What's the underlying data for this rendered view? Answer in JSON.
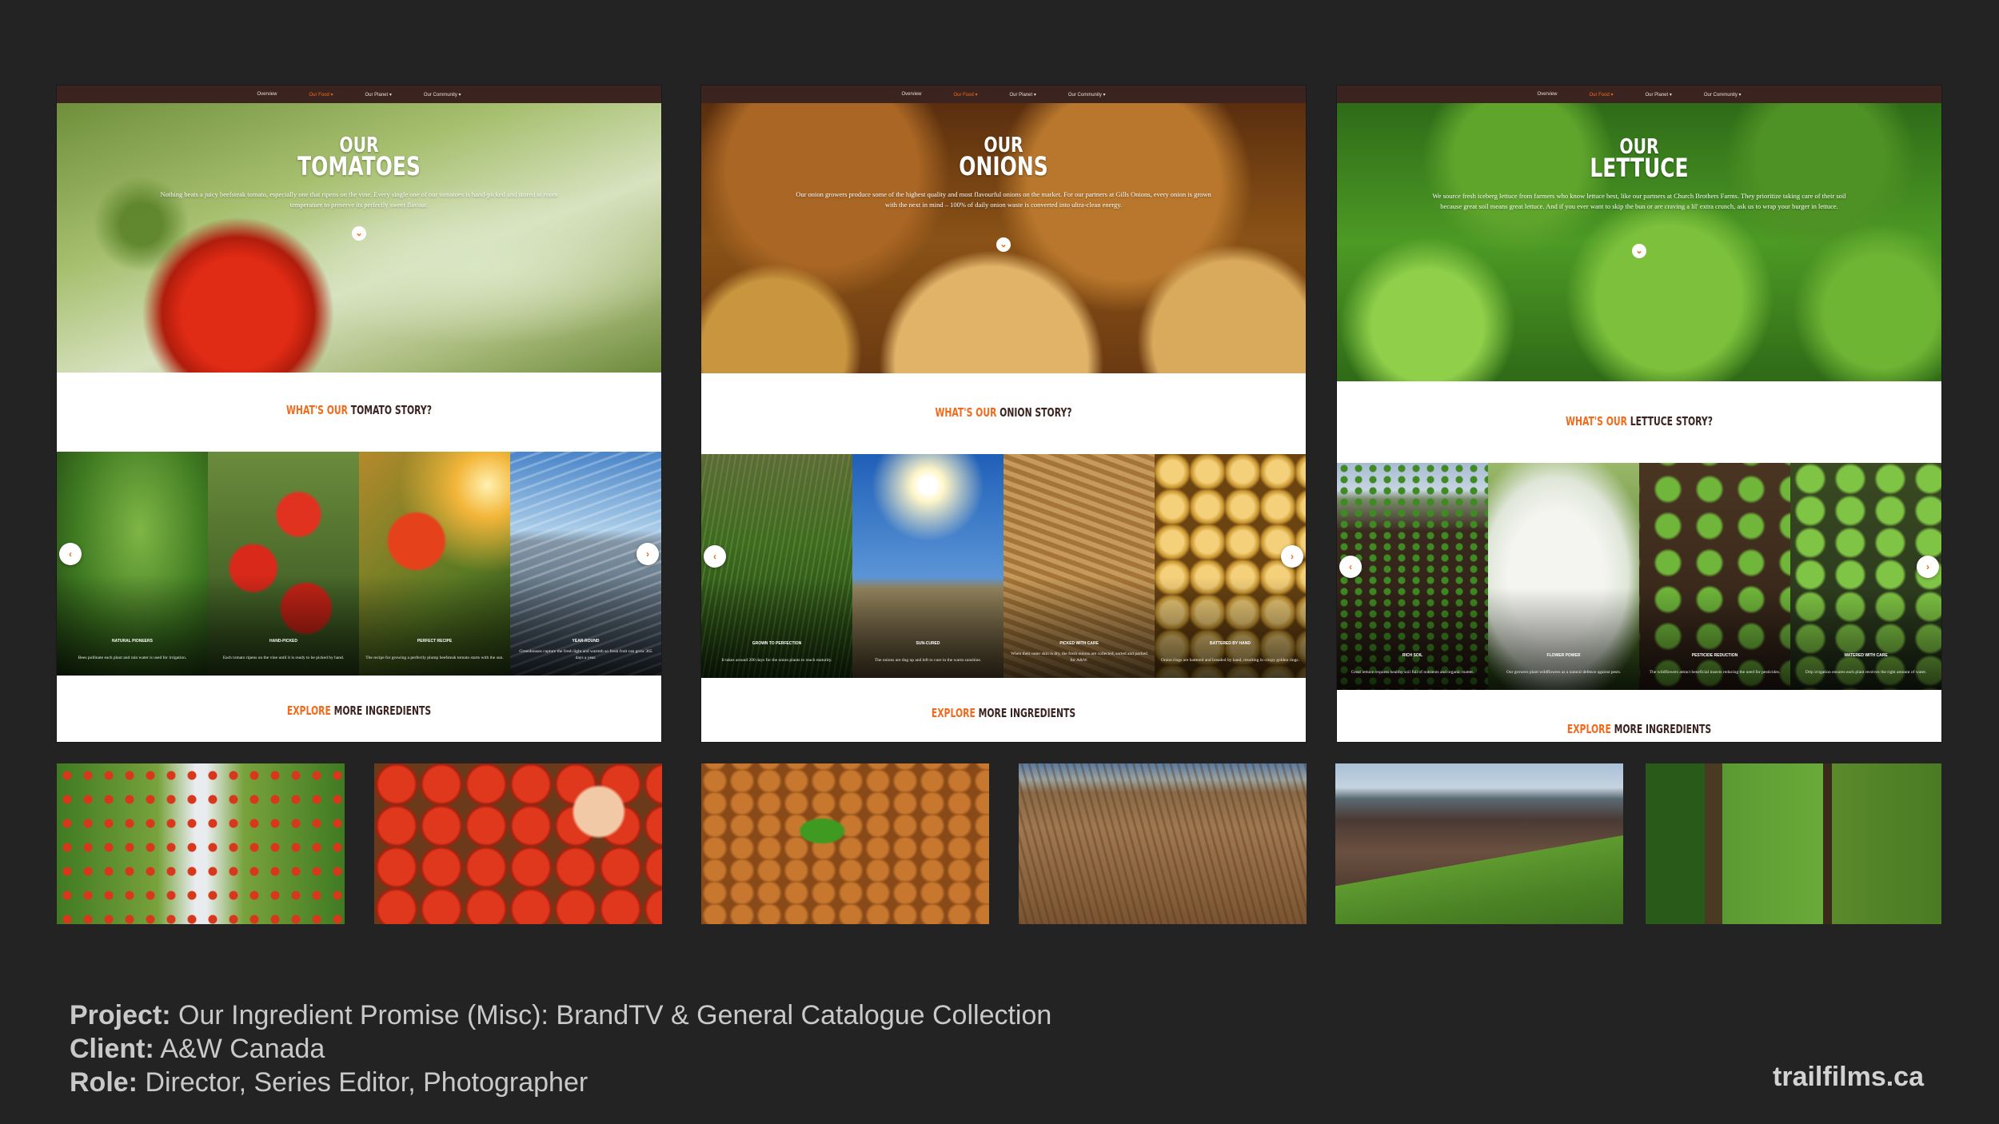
{
  "nav": {
    "items": [
      "Overview",
      "Our Food ▾",
      "Our Planet ▾",
      "Our Community ▾"
    ],
    "active_index": 1
  },
  "pages": [
    {
      "id": "tomatoes",
      "hero_line1": "OUR",
      "hero_line2": "TOMATOES",
      "hero_desc": "Nothing beats a juicy beefsteak tomato, especially one that ripens on the vine. Every single one of our tomatoes is hand-picked and stored at room temperature to preserve its perfectly sweet flavour.",
      "story_orange": "WHAT'S OUR",
      "story_dark": "TOMATO STORY?",
      "tiles": [
        {
          "title": "Natural Pioneers",
          "caption": "Bees pollinate each plant and rain water is used for irrigation."
        },
        {
          "title": "Hand-Picked",
          "caption": "Each tomato ripens on the vine until it is ready to be picked by hand."
        },
        {
          "title": "Perfect Recipe",
          "caption": "The recipe for growing a perfectly plump beefsteak tomato starts with the sun."
        },
        {
          "title": "Year-Round",
          "caption": "Greenhouses capture the fresh light and warmth so fresh fruit can grow 365 days a year."
        }
      ],
      "explore_orange": "EXPLORE",
      "explore_dark": "MORE INGREDIENTS"
    },
    {
      "id": "onions",
      "hero_line1": "OUR",
      "hero_line2": "ONIONS",
      "hero_desc": "Our onion growers produce some of the highest quality and most flavourful onions on the market. For our partners at Gills Onions, every onion is grown with the next in mind – 100% of daily onion waste is converted into ultra-clean energy.",
      "story_orange": "WHAT'S OUR",
      "story_dark": "ONION STORY?",
      "tiles": [
        {
          "title": "Grown to Perfection",
          "caption": "It takes around 200 days for the onion plants to reach maturity."
        },
        {
          "title": "Sun-Cured",
          "caption": "The onions are dug up and left to cure in the warm sunshine."
        },
        {
          "title": "Picked With Care",
          "caption": "When their outer skin is dry, the fresh onions are collected, sorted and packed for A&W."
        },
        {
          "title": "Battered by Hand",
          "caption": "Onion rings are battered and breaded by hand, resulting in crispy golden rings."
        }
      ],
      "explore_orange": "EXPLORE",
      "explore_dark": "MORE INGREDIENTS"
    },
    {
      "id": "lettuce",
      "hero_line1": "OUR",
      "hero_line2": "LETTUCE",
      "hero_desc": "We source fresh iceberg lettuce from farmers who know lettuce best, like our partners at Church Brothers Farms. They prioritize taking care of their soil because great soil means great lettuce. And if you ever want to skip the bun or are craving a lil' extra crunch, ask us to wrap your burger in lettuce.",
      "story_orange": "WHAT'S OUR",
      "story_dark": "LETTUCE STORY?",
      "tiles": [
        {
          "title": "Rich Soil",
          "caption": "Great lettuce requires healthy soil full of nutrients and organic matter."
        },
        {
          "title": "Flower Power",
          "caption": "Our growers plant wildflowers as a natural defence against pests."
        },
        {
          "title": "Pesticide Reduction",
          "caption": "The wildflowers attract beneficial insects reducing the need for pesticides."
        },
        {
          "title": "Watered With Care",
          "caption": "Drip irrigation ensures each plant receives the right amount of water."
        }
      ],
      "explore_orange": "EXPLORE",
      "explore_dark": "MORE INGREDIENTS"
    }
  ],
  "caption": {
    "project_label": "Project:",
    "project_value": " Our Ingredient Promise (Misc): BrandTV & General Catalogue Collection",
    "client_label": "Client:",
    "client_value": " A&W Canada",
    "role_label": "Role:",
    "role_value": " Director, Series Editor, Photographer"
  },
  "website": "trailfilms.ca",
  "colors": {
    "background": "#232323",
    "nav_bar": "#3b2420",
    "accent_orange": "#f26a1b",
    "heading_dark": "#3b2420"
  },
  "icons": {
    "hero_scroll": "chevron-down-icon",
    "carousel_prev": "chevron-left-icon",
    "carousel_next": "chevron-right-icon"
  }
}
